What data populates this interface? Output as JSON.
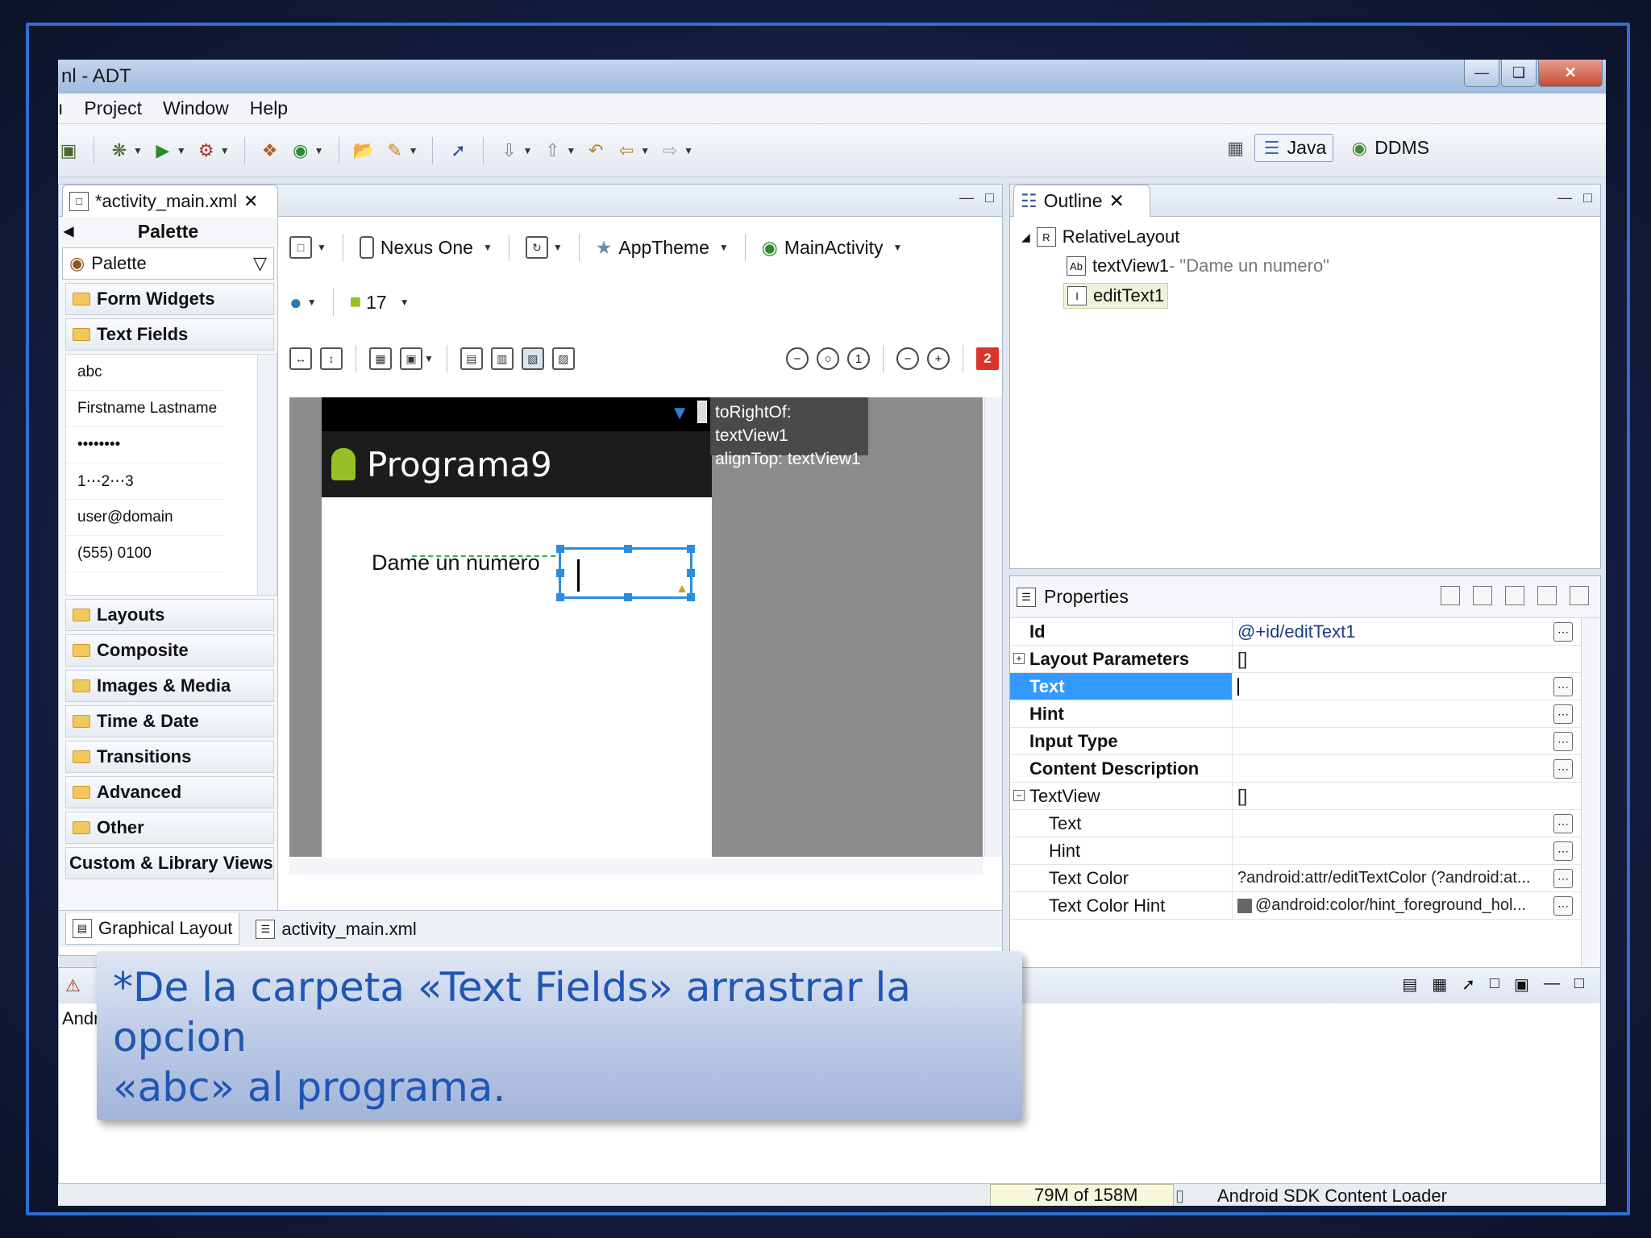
{
  "window": {
    "title": "nl - ADT"
  },
  "menu": [
    "Project",
    "Window",
    "Help"
  ],
  "perspectives": {
    "java": "Java",
    "ddms": "DDMS"
  },
  "editor": {
    "tab": "*activity_main.xml",
    "palette": {
      "header": "Palette",
      "combo": "Palette",
      "categories_top": [
        "Form Widgets",
        "Text Fields"
      ],
      "text_fields": [
        "abc",
        "Firstname Lastname",
        "••••••••",
        "1⋯2⋯3",
        "user@domain",
        "(555) 0100"
      ],
      "categories_bottom": [
        "Layouts",
        "Composite",
        "Images & Media",
        "Time & Date",
        "Transitions",
        "Advanced",
        "Other"
      ],
      "custom": "Custom & Library Views"
    },
    "canvas": {
      "device": "Nexus One",
      "theme": "AppTheme",
      "activity": "MainActivity",
      "api": "17",
      "error_count": "2",
      "app_title": "Programa9",
      "label": "Dame un numero",
      "tooltip_line1": "toRightOf: textView1",
      "tooltip_line2": "alignTop: textView1"
    },
    "bottom_tabs": [
      "Graphical Layout",
      "activity_main.xml"
    ]
  },
  "outline": {
    "tab": "Outline",
    "root": "RelativeLayout",
    "child1_name": "textView1",
    "child1_detail": " - \"Dame un numero\"",
    "child2_name": "editText1"
  },
  "properties": {
    "title": "Properties",
    "rows": [
      {
        "key": "Id",
        "value": "@+id/editText1"
      },
      {
        "key": "Layout Parameters",
        "value": "[]"
      },
      {
        "key": "Text",
        "value": ""
      },
      {
        "key": "Hint",
        "value": ""
      },
      {
        "key": "Input Type",
        "value": ""
      },
      {
        "key": "Content Description",
        "value": ""
      },
      {
        "key": "TextView",
        "value": "[]"
      },
      {
        "key": "Text",
        "value": ""
      },
      {
        "key": "Hint",
        "value": ""
      },
      {
        "key": "Text Color",
        "value": "?android:attr/editTextColor (?android:at..."
      },
      {
        "key": "Text Color Hint",
        "value": "@android:color/hint_foreground_hol..."
      }
    ]
  },
  "console": {
    "body_text": "Andr"
  },
  "status": {
    "memory": "79M of 158M",
    "loader": "Android SDK Content Loader"
  },
  "caption": {
    "line1": "*De la carpeta «Text Fields» arrastrar la opcion",
    "line2": "«abc» al programa."
  }
}
